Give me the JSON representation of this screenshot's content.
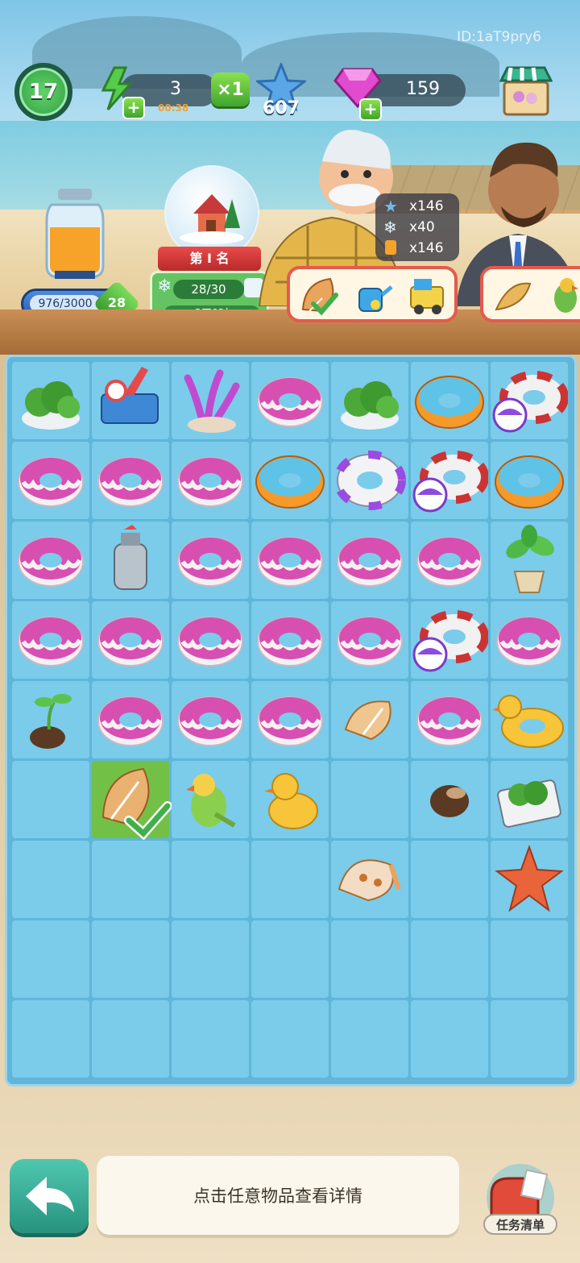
{
  "hud": {
    "player_id": "ID:1aT9pry6",
    "level": "17",
    "energy": "3",
    "energy_timer": "00:38",
    "multiplier": "×1",
    "stars": "607",
    "gems": "159"
  },
  "jar": {
    "progress": "976/3000",
    "badge": "28"
  },
  "event": {
    "rank": "第 I 名",
    "progress": "28/30",
    "time_left": "3天9时"
  },
  "order": {
    "counts": [
      "x146",
      "x40",
      "x146"
    ]
  },
  "hint_text": "点击任意物品查看详情",
  "task_list_label": "任务清单",
  "colors": {
    "board": "#5fb6d9",
    "cell": "#7bcbeb",
    "selected_cell": "#73c047",
    "accent_green": "#3fa52e"
  },
  "board": {
    "columns": 7,
    "rows": 9,
    "cells": [
      [
        "cactus-pot",
        "surf-cart",
        "coral",
        "pink-donut-float",
        "cactus-pot",
        "orange-donut-float",
        "life-ring-ball"
      ],
      [
        "pink-donut-float",
        "pink-donut-float",
        "pink-donut-float",
        "orange-donut-float",
        "purple-life-ring",
        "life-ring-ball",
        "orange-donut-float"
      ],
      [
        "pink-donut-float",
        "fire-extinguisher",
        "pink-donut-float",
        "pink-donut-float",
        "pink-donut-float",
        "pink-donut-float",
        "potted-plant"
      ],
      [
        "pink-donut-float",
        "pink-donut-float",
        "pink-donut-float",
        "pink-donut-float",
        "pink-donut-float",
        "life-ring-ball",
        "pink-donut-float"
      ],
      [
        "sprout-seed",
        "pink-donut-float",
        "pink-donut-float",
        "pink-donut-float",
        "spiral-shell",
        "pink-donut-float",
        "duck-float"
      ],
      [
        "",
        "conch-shell",
        "parrot",
        "rubber-duck",
        "",
        "seed",
        "cactus-crate"
      ],
      [
        "",
        "",
        "",
        "",
        "spotted-shell",
        "",
        "starfish"
      ],
      [
        "",
        "",
        "",
        "",
        "",
        "",
        ""
      ],
      [
        "",
        "",
        "",
        "",
        "",
        "",
        ""
      ]
    ],
    "selected": "conch-shell"
  }
}
